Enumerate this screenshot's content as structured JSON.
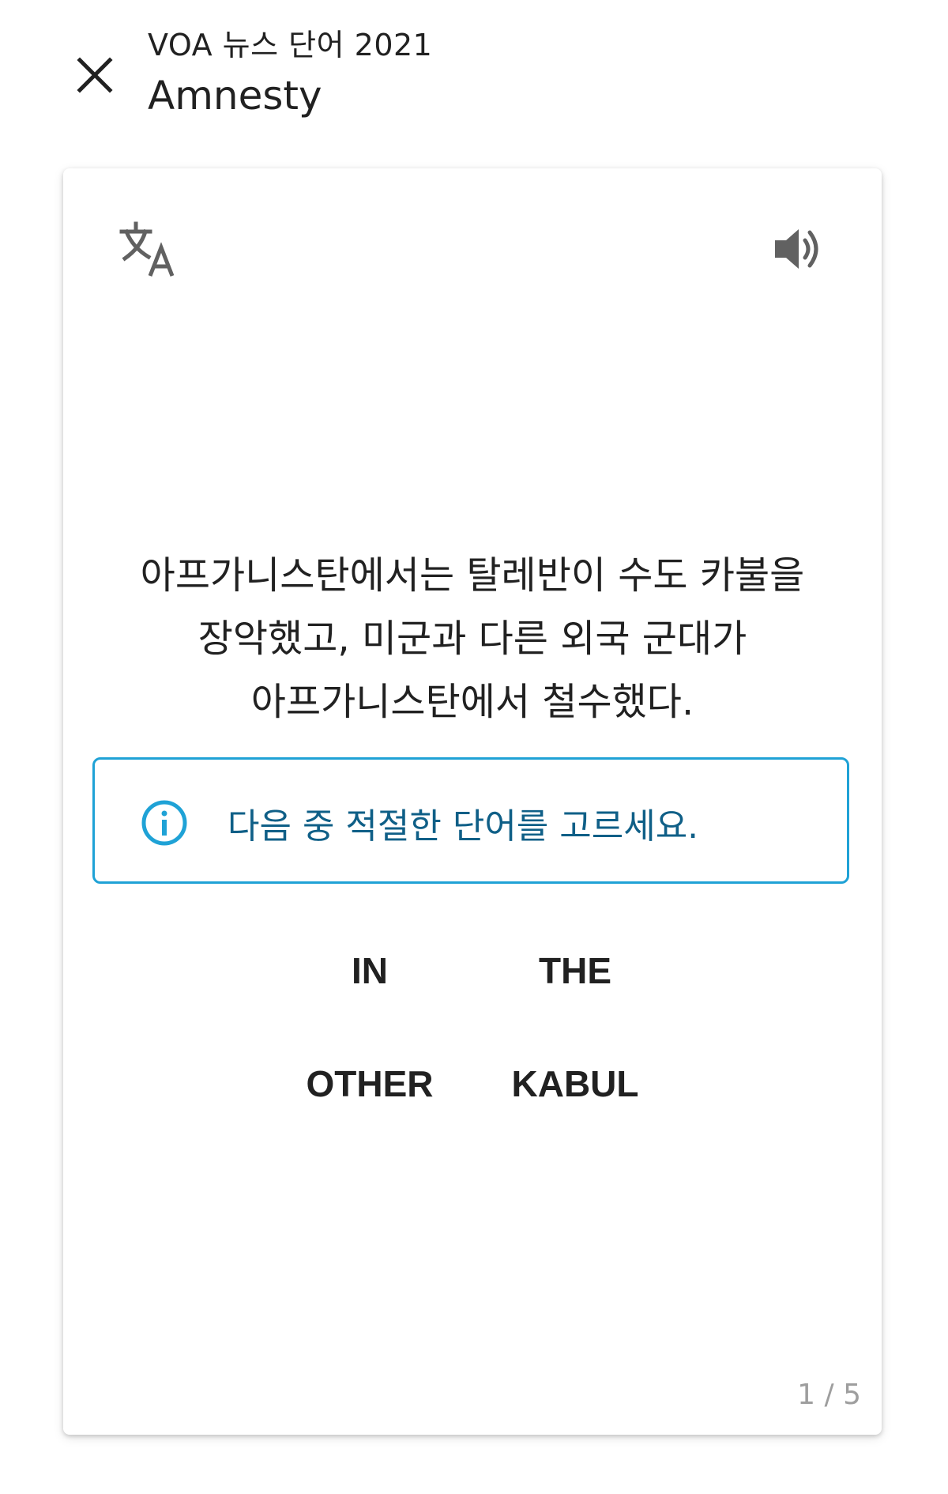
{
  "header": {
    "subtitle": "VOA 뉴스 단어 2021",
    "title": "Amnesty"
  },
  "icons": {
    "close": "close-icon",
    "translate": "translate-icon",
    "speaker": "volume-up-icon",
    "info": "info-icon"
  },
  "card": {
    "sentence_lines": [
      "아프가니스탄에서는 탈레반이 수도 카불을",
      "장악했고, 미군과 다른 외국 군대가",
      "아프가니스탄에서 철수했다."
    ],
    "instruction": "다음 중 적절한 단어를 고르세요.",
    "options": [
      "IN",
      "THE",
      "OTHER",
      "KABUL"
    ],
    "page_counter": "1 / 5"
  },
  "colors": {
    "accent": "#1fa2d6",
    "instruction_text": "#0f5f87",
    "counter_text": "#9e9e9e"
  }
}
